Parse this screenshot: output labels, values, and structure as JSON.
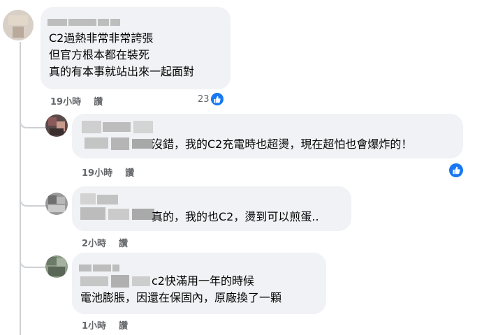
{
  "comments": [
    {
      "lines": [
        "C2過熱非常非常誇張",
        "但官方根本都在裝死",
        "真的有本事就站出來一起面對"
      ],
      "time": "19小時",
      "reply": "讚",
      "reaction_count": "23"
    },
    {
      "text": "沒錯，我的C2充電時也超燙，現在超怕也會爆炸的！",
      "time": "19小時",
      "reply": "讚"
    },
    {
      "text": "真的，我的也C2，燙到可以煎蛋..",
      "time": "2小時",
      "reply": "讚"
    },
    {
      "lines": [
        "c2快滿用一年的時候",
        "電池膨脹，因還在保固內，原廠換了一顆"
      ],
      "time": "1小時",
      "reply": "讚"
    }
  ],
  "colors": {
    "bubble": "#f0f2f5",
    "meta": "#65676b",
    "like": "#1877f2"
  },
  "icons": {
    "reaction": "thumbs-up-icon"
  }
}
